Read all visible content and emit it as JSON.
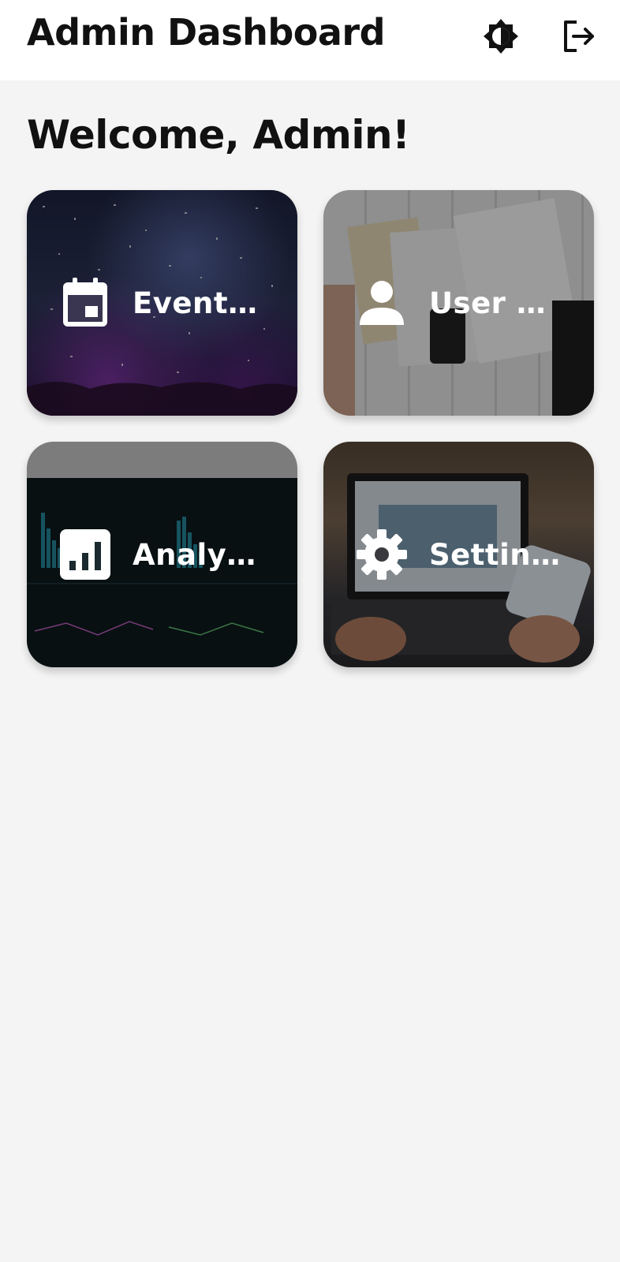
{
  "appbar": {
    "title": "Admin Dashboard",
    "theme_icon": "brightness-toggle-icon",
    "logout_icon": "logout-icon"
  },
  "welcome": "Welcome, Admin!",
  "cards": [
    {
      "label": "Event ...",
      "icon": "calendar-icon"
    },
    {
      "label": "User Pr...",
      "icon": "person-icon"
    },
    {
      "label": "Analyti...",
      "icon": "bar-chart-icon"
    },
    {
      "label": "Settings",
      "icon": "gear-icon"
    }
  ]
}
